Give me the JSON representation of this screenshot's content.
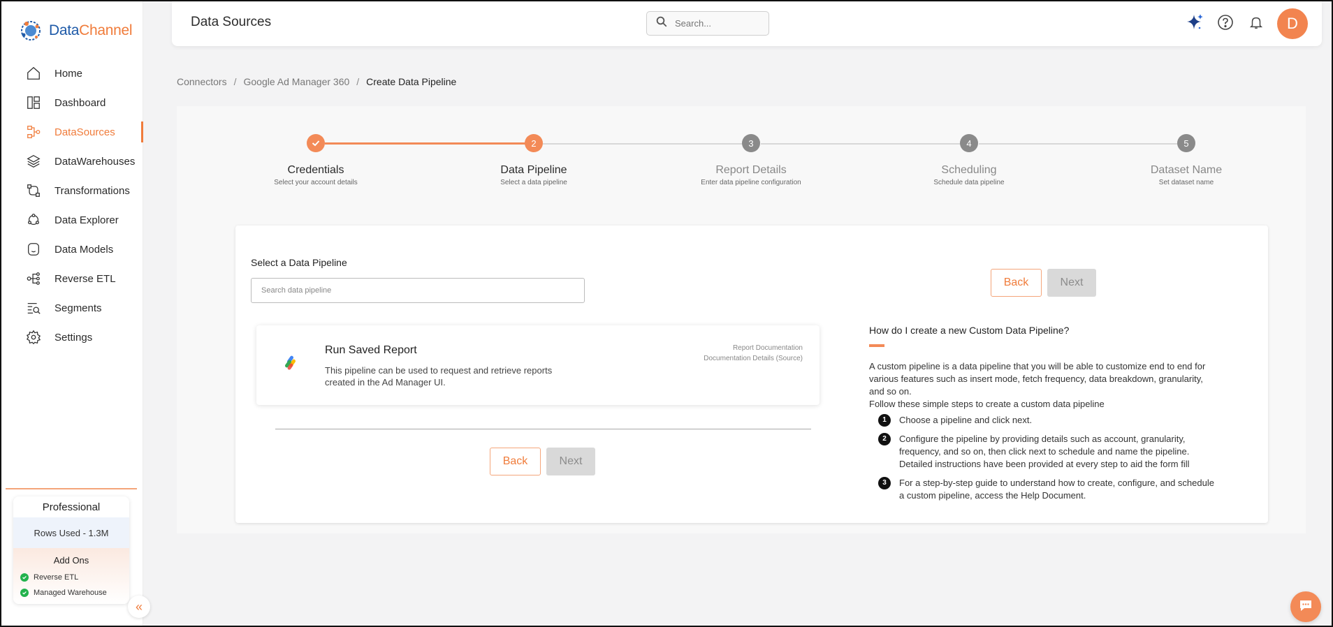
{
  "brand": {
    "name_part1": "Data",
    "name_part2": "Channel"
  },
  "sidebar": {
    "items": [
      {
        "label": "Home",
        "icon": "home-icon"
      },
      {
        "label": "Dashboard",
        "icon": "dashboard-icon"
      },
      {
        "label": "DataSources",
        "icon": "datasources-icon",
        "active": true
      },
      {
        "label": "DataWarehouses",
        "icon": "datawarehouses-icon"
      },
      {
        "label": "Transformations",
        "icon": "transformations-icon"
      },
      {
        "label": "Data Explorer",
        "icon": "data-explorer-icon"
      },
      {
        "label": "Data Models",
        "icon": "data-models-icon"
      },
      {
        "label": "Reverse ETL",
        "icon": "reverse-etl-icon"
      },
      {
        "label": "Segments",
        "icon": "segments-icon"
      },
      {
        "label": "Settings",
        "icon": "settings-icon"
      }
    ],
    "plan": {
      "title": "Professional",
      "rows_used": "Rows Used - 1.3M",
      "addons_title": "Add Ons",
      "addons": [
        "Reverse ETL",
        "Managed Warehouse"
      ]
    }
  },
  "header": {
    "title": "Data Sources",
    "search_placeholder": "Search...",
    "avatar_initial": "D"
  },
  "breadcrumb": [
    "Connectors",
    "Google Ad Manager 360",
    "Create Data Pipeline"
  ],
  "stepper": [
    {
      "number": "1",
      "title": "Credentials",
      "subtitle": "Select your account details",
      "state": "done"
    },
    {
      "number": "2",
      "title": "Data Pipeline",
      "subtitle": "Select a data pipeline",
      "state": "current"
    },
    {
      "number": "3",
      "title": "Report Details",
      "subtitle": "Enter data pipeline configuration",
      "state": "todo"
    },
    {
      "number": "4",
      "title": "Scheduling",
      "subtitle": "Schedule data pipeline",
      "state": "todo"
    },
    {
      "number": "5",
      "title": "Dataset Name",
      "subtitle": "Set dataset name",
      "state": "todo"
    }
  ],
  "form": {
    "select_label": "Select a Data Pipeline",
    "search_placeholder": "Search data pipeline",
    "pipeline": {
      "title": "Run Saved Report",
      "description": "This pipeline can be used to request and retrieve reports created in the Ad Manager UI.",
      "link_report_doc": "Report Documentation",
      "link_source_doc": "Documentation Details (Source)"
    },
    "back_label": "Back",
    "next_label": "Next"
  },
  "help": {
    "title": "How do I create a new Custom Data Pipeline?",
    "description_1": "A custom pipeline is a data pipeline that you will be able to customize end to end for various features such as insert mode, fetch frequency, data breakdown, granularity, and so on.",
    "description_2": "Follow these simple steps to create a custom data pipeline",
    "steps": [
      {
        "num": "1",
        "text": "Choose a pipeline and click next."
      },
      {
        "num": "2",
        "text": "Configure the pipeline by providing details such as account, granularity, frequency, and so on, then click next to schedule and name the pipeline. Detailed instructions have been provided at every step to aid the form fill"
      },
      {
        "num": "3",
        "text": "For a step-by-step guide to understand how to create, configure, and schedule a custom pipeline, access the Help Document."
      }
    ]
  },
  "colors": {
    "accent": "#f07c3b",
    "brand_blue": "#1e5aa8",
    "success": "#22b24c"
  }
}
